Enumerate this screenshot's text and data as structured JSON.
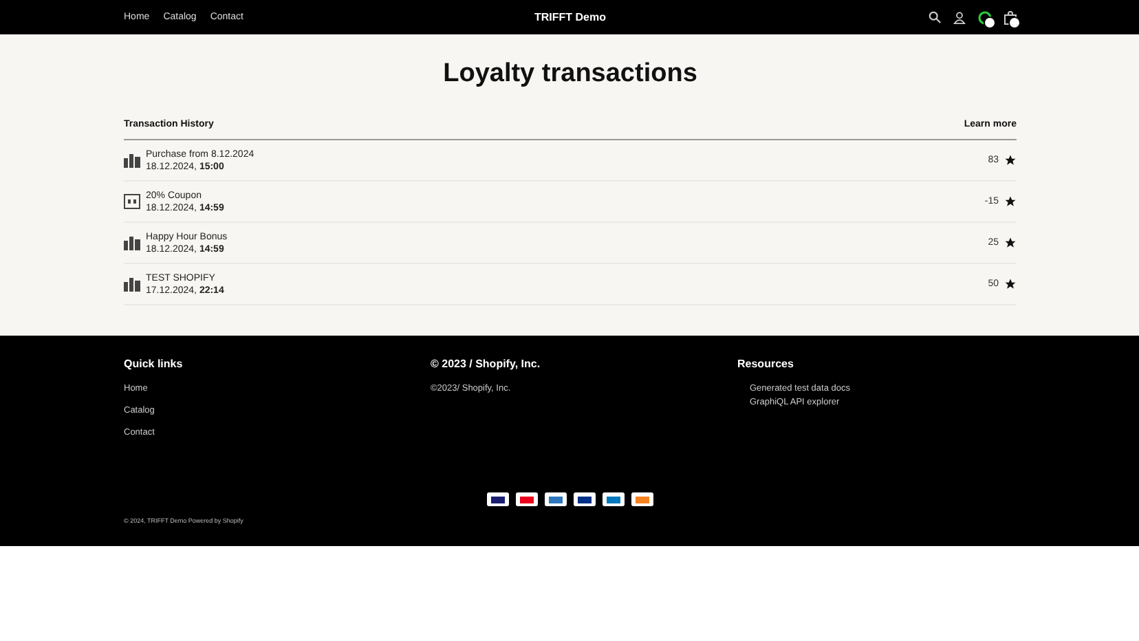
{
  "header": {
    "nav": [
      "Home",
      "Catalog",
      "Contact"
    ],
    "brand": "TRIFFT Demo"
  },
  "page": {
    "title": "Loyalty transactions",
    "history_label": "Transaction History",
    "learn_more": "Learn more",
    "transactions": [
      {
        "kind": "purchase",
        "title": "Purchase from 8.12.2024",
        "date": "18.12.2024, ",
        "time": "15:00",
        "points": "83"
      },
      {
        "kind": "coupon",
        "title": "20% Coupon",
        "date": "18.12.2024, ",
        "time": "14:59",
        "points": "-15"
      },
      {
        "kind": "purchase",
        "title": "Happy Hour Bonus",
        "date": "18.12.2024, ",
        "time": "14:59",
        "points": "25"
      },
      {
        "kind": "purchase",
        "title": "TEST SHOPIFY",
        "date": "17.12.2024, ",
        "time": "22:14",
        "points": "50"
      }
    ]
  },
  "footer": {
    "columns": [
      {
        "heading": "Quick links",
        "kind": "links",
        "items": [
          "Home",
          "Catalog",
          "Contact"
        ]
      },
      {
        "heading": "© 2023 / Shopify, Inc.",
        "kind": "text",
        "items": [
          "©2023/ Shopify, Inc."
        ]
      },
      {
        "heading": "Resources",
        "kind": "resources",
        "items": [
          "Generated test data docs",
          "GraphiQL API explorer"
        ]
      }
    ],
    "payments": [
      {
        "color": "#1a1f71"
      },
      {
        "color": "#eb001b"
      },
      {
        "color": "#2e77bc"
      },
      {
        "color": "#003087"
      },
      {
        "color": "#0079be"
      },
      {
        "color": "#f58220"
      }
    ],
    "copyright": "© 2024, TRIFFT Demo Powered by Shopify"
  }
}
